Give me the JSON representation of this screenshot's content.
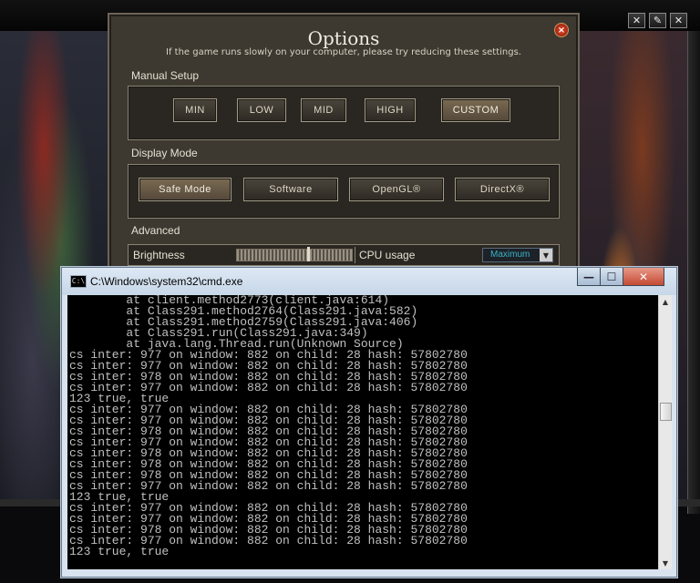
{
  "game_window": {
    "controls": [
      {
        "name": "sound-toggle-icon",
        "glyph": "✕"
      },
      {
        "name": "wrench-icon",
        "glyph": "✎"
      },
      {
        "name": "close-icon",
        "glyph": "✕"
      }
    ]
  },
  "options": {
    "title": "Options",
    "subtitle": "If the game runs slowly on your computer, please try reducing these settings.",
    "close_glyph": "×",
    "manual_setup": {
      "label": "Manual Setup",
      "buttons": [
        "MIN",
        "LOW",
        "MID",
        "HIGH",
        "CUSTOM"
      ],
      "selected": "CUSTOM"
    },
    "display_mode": {
      "label": "Display Mode",
      "buttons": [
        "Safe Mode",
        "Software",
        "OpenGL®",
        "DirectX®"
      ],
      "selected": "Safe Mode"
    },
    "advanced": {
      "label": "Advanced",
      "brightness_label": "Brightness",
      "brightness_level": 0.62,
      "cpu_usage_label": "CPU usage",
      "cpu_usage_value": "Maximum",
      "dropdown_glyph": "▼"
    }
  },
  "cmd": {
    "title": "C:\\Windows\\system32\\cmd.exe",
    "icon_glyph": "C:\\",
    "buttons": {
      "minimize": "—",
      "maximize": "☐",
      "close": "✕"
    },
    "scroll_up": "▲",
    "scroll_down": "▼",
    "lines": [
      "        at client.method2773(client.java:614)",
      "        at Class291.method2764(Class291.java:582)",
      "        at Class291.method2759(Class291.java:406)",
      "        at Class291.run(Class291.java:349)",
      "        at java.lang.Thread.run(Unknown Source)",
      "cs inter: 977 on window: 882 on child: 28 hash: 57802780",
      "cs inter: 977 on window: 882 on child: 28 hash: 57802780",
      "cs inter: 978 on window: 882 on child: 28 hash: 57802780",
      "cs inter: 977 on window: 882 on child: 28 hash: 57802780",
      "123 true, true",
      "cs inter: 977 on window: 882 on child: 28 hash: 57802780",
      "cs inter: 977 on window: 882 on child: 28 hash: 57802780",
      "cs inter: 978 on window: 882 on child: 28 hash: 57802780",
      "cs inter: 977 on window: 882 on child: 28 hash: 57802780",
      "cs inter: 978 on window: 882 on child: 28 hash: 57802780",
      "cs inter: 978 on window: 882 on child: 28 hash: 57802780",
      "cs inter: 978 on window: 882 on child: 28 hash: 57802780",
      "cs inter: 977 on window: 882 on child: 28 hash: 57802780",
      "123 true, true",
      "cs inter: 977 on window: 882 on child: 28 hash: 57802780",
      "cs inter: 977 on window: 882 on child: 28 hash: 57802780",
      "cs inter: 978 on window: 882 on child: 28 hash: 57802780",
      "cs inter: 977 on window: 882 on child: 28 hash: 57802780",
      "123 true, true"
    ]
  }
}
